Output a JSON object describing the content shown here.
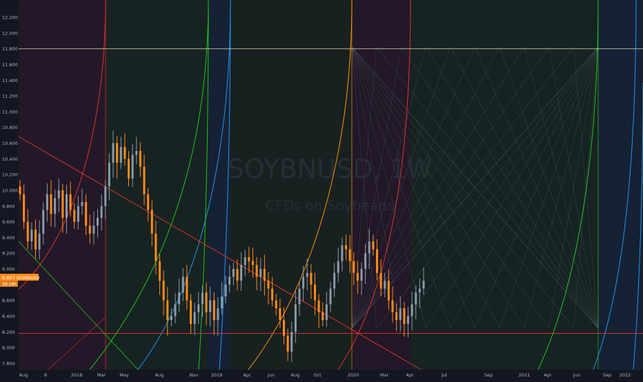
{
  "watermark": {
    "symbol": "SOYBNUSD, 1W",
    "description": "CFDs on Soybeans"
  },
  "price_badge": {
    "price": "8.827",
    "symbol": "SOYBNUSD",
    "countdown": "3d 16h"
  },
  "colors": {
    "background": "#131722",
    "up": "#8a9ba8",
    "down": "#ff8c1a",
    "axis_text": "#b2b5be",
    "red": "#e0332f",
    "green": "#21c421",
    "blue": "#2196f3",
    "orange": "#ff9800",
    "grid_line": "#2a2e39"
  },
  "chart_data": {
    "type": "candlestick",
    "ylim": [
      7.72,
      12.42
    ],
    "y_ticks": [
      "12.200",
      "12.000",
      "11.800",
      "11.600",
      "11.400",
      "11.200",
      "11.000",
      "10.800",
      "10.600",
      "10.400",
      "10.200",
      "10.000",
      "9.800",
      "9.600",
      "9.400",
      "9.200",
      "9.000",
      "8.800",
      "8.600",
      "8.400",
      "8.200",
      "8.000",
      "7.800"
    ],
    "x_ticks": [
      "Aug",
      "9",
      "2018",
      "Mar",
      "May",
      "Aug",
      "Nov",
      "2019",
      "Apr",
      "Jun",
      "Aug",
      "Oct",
      "2020",
      "Mar",
      "Apr",
      "Jul",
      "Sep",
      "2021",
      "Apr",
      "Jun",
      "Sep",
      "2022"
    ],
    "horizontal_levels": [
      11.8,
      8.18
    ],
    "current_price": 8.827,
    "price_series_close": [
      9.95,
      9.6,
      9.35,
      9.5,
      9.25,
      9.45,
      9.75,
      9.95,
      9.7,
      9.9,
      10.0,
      9.65,
      9.95,
      9.75,
      9.6,
      9.8,
      9.85,
      9.55,
      9.45,
      9.55,
      9.65,
      9.8,
      10.05,
      10.35,
      10.6,
      10.35,
      10.55,
      10.4,
      10.15,
      10.45,
      10.5,
      10.3,
      9.95,
      9.75,
      9.45,
      9.1,
      8.85,
      8.6,
      8.35,
      8.4,
      8.55,
      8.7,
      8.9,
      8.6,
      8.3,
      8.45,
      8.55,
      8.7,
      8.45,
      8.6,
      8.35,
      8.5,
      8.65,
      8.8,
      8.9,
      9.0,
      8.85,
      9.05,
      9.15,
      9.1,
      9.05,
      8.9,
      9.0,
      8.85,
      8.75,
      8.6,
      8.5,
      8.35,
      8.15,
      7.95,
      8.2,
      8.55,
      8.75,
      8.9,
      8.95,
      8.8,
      8.6,
      8.45,
      8.35,
      8.55,
      8.75,
      8.95,
      9.1,
      9.3,
      9.25,
      9.1,
      8.95,
      8.85,
      9.0,
      9.2,
      9.35,
      9.25,
      8.95,
      8.75,
      8.85,
      8.6,
      8.45,
      8.35,
      8.5,
      8.3,
      8.4,
      8.55,
      8.7,
      8.75,
      8.85
    ]
  }
}
